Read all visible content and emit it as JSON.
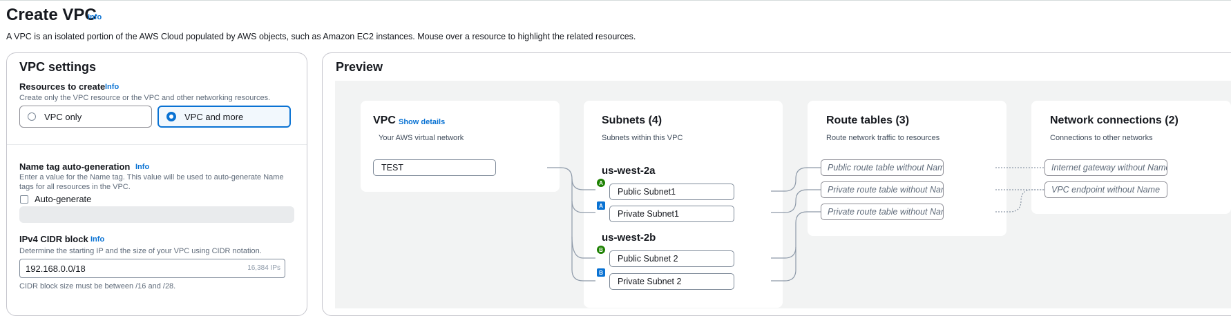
{
  "page": {
    "title": "Create VPC",
    "title_info": "Info",
    "description": "A VPC is an isolated portion of the AWS Cloud populated by AWS objects, such as Amazon EC2 instances. Mouse over a resource to highlight the related resources."
  },
  "settings": {
    "heading": "VPC settings",
    "resources": {
      "label": "Resources to create",
      "info": "Info",
      "hint": "Create only the VPC resource or the VPC and other networking resources.",
      "options": [
        {
          "label": "VPC only",
          "selected": false
        },
        {
          "label": "VPC and more",
          "selected": true
        }
      ]
    },
    "name_tag": {
      "label": "Name tag auto-generation",
      "info": "Info",
      "hint_line1": "Enter a value for the Name tag. This value will be used to auto-generate Name",
      "hint_line2": "tags for all resources in the VPC.",
      "checkbox_label": "Auto-generate",
      "checked": false
    },
    "cidr": {
      "label": "IPv4 CIDR block",
      "info": "Info",
      "hint": "Determine the starting IP and the size of your VPC using CIDR notation.",
      "value": "192.168.0.0/18",
      "ips": "16,384 IPs",
      "constraint": "CIDR block size must be between /16 and /28."
    }
  },
  "preview": {
    "heading": "Preview",
    "vpc": {
      "title": "VPC",
      "link": "Show details",
      "subtitle": "Your AWS virtual network",
      "name": "TEST"
    },
    "subnets": {
      "title": "Subnets (4)",
      "subtitle": "Subnets within this VPC",
      "zones": [
        {
          "name": "us-west-2a",
          "subnets": [
            {
              "badge": "A",
              "type": "public",
              "label": "Public Subnet1"
            },
            {
              "badge": "A",
              "type": "private",
              "label": "Private Subnet1"
            }
          ]
        },
        {
          "name": "us-west-2b",
          "subnets": [
            {
              "badge": "B",
              "type": "public",
              "label": "Public Subnet 2"
            },
            {
              "badge": "B",
              "type": "private",
              "label": "Private Subnet 2"
            }
          ]
        }
      ]
    },
    "route_tables": {
      "title": "Route tables (3)",
      "subtitle": "Route network traffic to resources",
      "items": [
        "Public route table without Name",
        "Private route table without Name",
        "Private route table without Name"
      ]
    },
    "network": {
      "title": "Network connections (2)",
      "subtitle": "Connections to other networks",
      "items": [
        "Internet gateway without Name",
        "VPC endpoint without Name"
      ]
    }
  },
  "colors": {
    "accent": "#0972d3",
    "public_badge": "#1d8102",
    "private_badge": "#0972d3",
    "preview_background": "#f2f3f3"
  }
}
